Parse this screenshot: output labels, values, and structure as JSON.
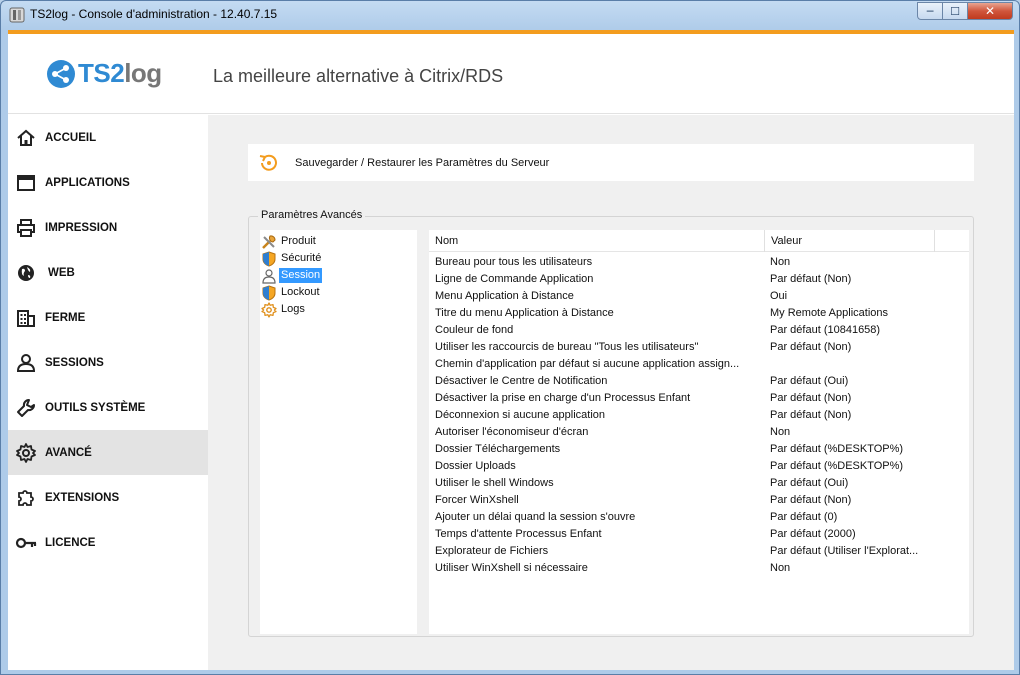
{
  "window": {
    "title": "TS2log - Console d'administration - 12.40.7.15",
    "buttons": {
      "minimize": "─",
      "maximize": "☐",
      "close": "✕"
    }
  },
  "header": {
    "logo_ts": "TS2",
    "logo_log": "log",
    "tagline": "La meilleure alternative à Citrix/RDS"
  },
  "colors": {
    "accent": "#f39c1e",
    "brand": "#2f8ad3",
    "selection": "#3399ff"
  },
  "sidebar": {
    "items": [
      {
        "label": "ACCUEIL",
        "icon": "home-icon"
      },
      {
        "label": "APPLICATIONS",
        "icon": "window-icon"
      },
      {
        "label": "IMPRESSION",
        "icon": "printer-icon"
      },
      {
        "label": "WEB",
        "icon": "globe-icon"
      },
      {
        "label": "FERME",
        "icon": "building-icon"
      },
      {
        "label": "SESSIONS",
        "icon": "user-icon"
      },
      {
        "label": "OUTILS SYSTÈME",
        "icon": "wrench-icon"
      },
      {
        "label": "AVANCÉ",
        "icon": "gear-icon",
        "active": true
      },
      {
        "label": "EXTENSIONS",
        "icon": "puzzle-icon"
      },
      {
        "label": "LICENCE",
        "icon": "key-icon"
      }
    ]
  },
  "main": {
    "backup_label": "Sauvegarder / Restaurer les Paramètres du Serveur",
    "group_title": "Paramètres Avancés",
    "tree": [
      {
        "label": "Produit",
        "icon": "tools-icon"
      },
      {
        "label": "Sécurité",
        "icon": "shield-icon"
      },
      {
        "label": "Session",
        "icon": "user-icon",
        "selected": true
      },
      {
        "label": "Lockout",
        "icon": "shield-icon"
      },
      {
        "label": "Logs",
        "icon": "gear-icon"
      }
    ],
    "grid": {
      "columns": [
        "Nom",
        "Valeur"
      ],
      "rows": [
        {
          "name": "Bureau pour tous les utilisateurs",
          "value": "Non"
        },
        {
          "name": "Ligne de Commande Application",
          "value": "Par défaut (Non)"
        },
        {
          "name": "Menu Application à Distance",
          "value": "Oui"
        },
        {
          "name": "Titre du menu Application à Distance",
          "value": "My Remote Applications"
        },
        {
          "name": "Couleur de fond",
          "value": "Par défaut (10841658)"
        },
        {
          "name": "Utiliser les raccourcis de bureau \"Tous les utilisateurs\"",
          "value": "Par défaut (Non)"
        },
        {
          "name": "Chemin d'application par défaut si aucune application assign...",
          "value": ""
        },
        {
          "name": "Désactiver le Centre de Notification",
          "value": "Par défaut (Oui)"
        },
        {
          "name": "Désactiver la prise en charge d'un Processus Enfant",
          "value": "Par défaut (Non)"
        },
        {
          "name": "Déconnexion si aucune application",
          "value": "Par défaut (Non)"
        },
        {
          "name": "Autoriser l'économiseur d'écran",
          "value": "Non"
        },
        {
          "name": "Dossier Téléchargements",
          "value": "Par défaut (%DESKTOP%)"
        },
        {
          "name": "Dossier Uploads",
          "value": "Par défaut (%DESKTOP%)"
        },
        {
          "name": "Utiliser le shell Windows",
          "value": "Par défaut (Oui)"
        },
        {
          "name": "Forcer WinXshell",
          "value": "Par défaut (Non)"
        },
        {
          "name": "Ajouter un délai quand la session s'ouvre",
          "value": "Par défaut (0)"
        },
        {
          "name": "Temps d'attente Processus Enfant",
          "value": "Par défaut (2000)"
        },
        {
          "name": "Explorateur de Fichiers",
          "value": "Par défaut (Utiliser l'Explorat..."
        },
        {
          "name": "Utiliser WinXshell si nécessaire",
          "value": "Non"
        }
      ]
    }
  }
}
